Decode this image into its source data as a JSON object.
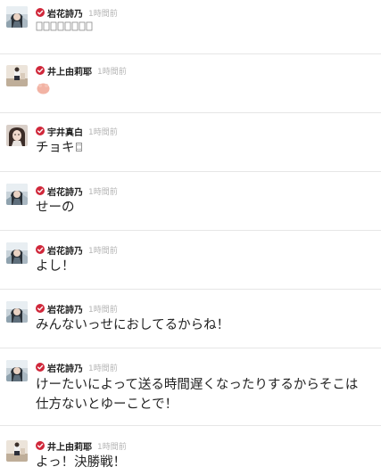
{
  "colors": {
    "verified_badge": "#d0273a",
    "name": "#222222",
    "time": "#b5b5b5",
    "separator": "#e6e6e6",
    "emoji_pink": "#f2b3a4"
  },
  "posts": [
    {
      "author": "岩花詩乃",
      "time": "1時間前",
      "text": "",
      "avatar": "avatar-iwahana",
      "content": "emoji-row"
    },
    {
      "author": "井上由莉耶",
      "time": "1時間前",
      "text": "",
      "avatar": "avatar-inoue",
      "content": "emoji-pink"
    },
    {
      "author": "宇井真白",
      "time": "1時間前",
      "text": "チョキ",
      "avatar": "avatar-ui",
      "content": "text-with-emoji"
    },
    {
      "author": "岩花詩乃",
      "time": "1時間前",
      "text": "せーの",
      "avatar": "avatar-iwahana",
      "content": "text"
    },
    {
      "author": "岩花詩乃",
      "time": "1時間前",
      "text": "よし！",
      "avatar": "avatar-iwahana",
      "content": "text"
    },
    {
      "author": "岩花詩乃",
      "time": "1時間前",
      "text": "みんないっせにおしてるからね！",
      "avatar": "avatar-iwahana",
      "content": "text"
    },
    {
      "author": "岩花詩乃",
      "time": "1時間前",
      "text_lines": [
        "けーたいによって送る時間遅くなったりするからそこは",
        "仕方ないとゆーことで！"
      ],
      "avatar": "avatar-iwahana",
      "content": "text"
    },
    {
      "author": "井上由莉耶",
      "time": "1時間前",
      "text": "よっ！決勝戦！",
      "avatar": "avatar-inoue",
      "content": "text"
    }
  ]
}
